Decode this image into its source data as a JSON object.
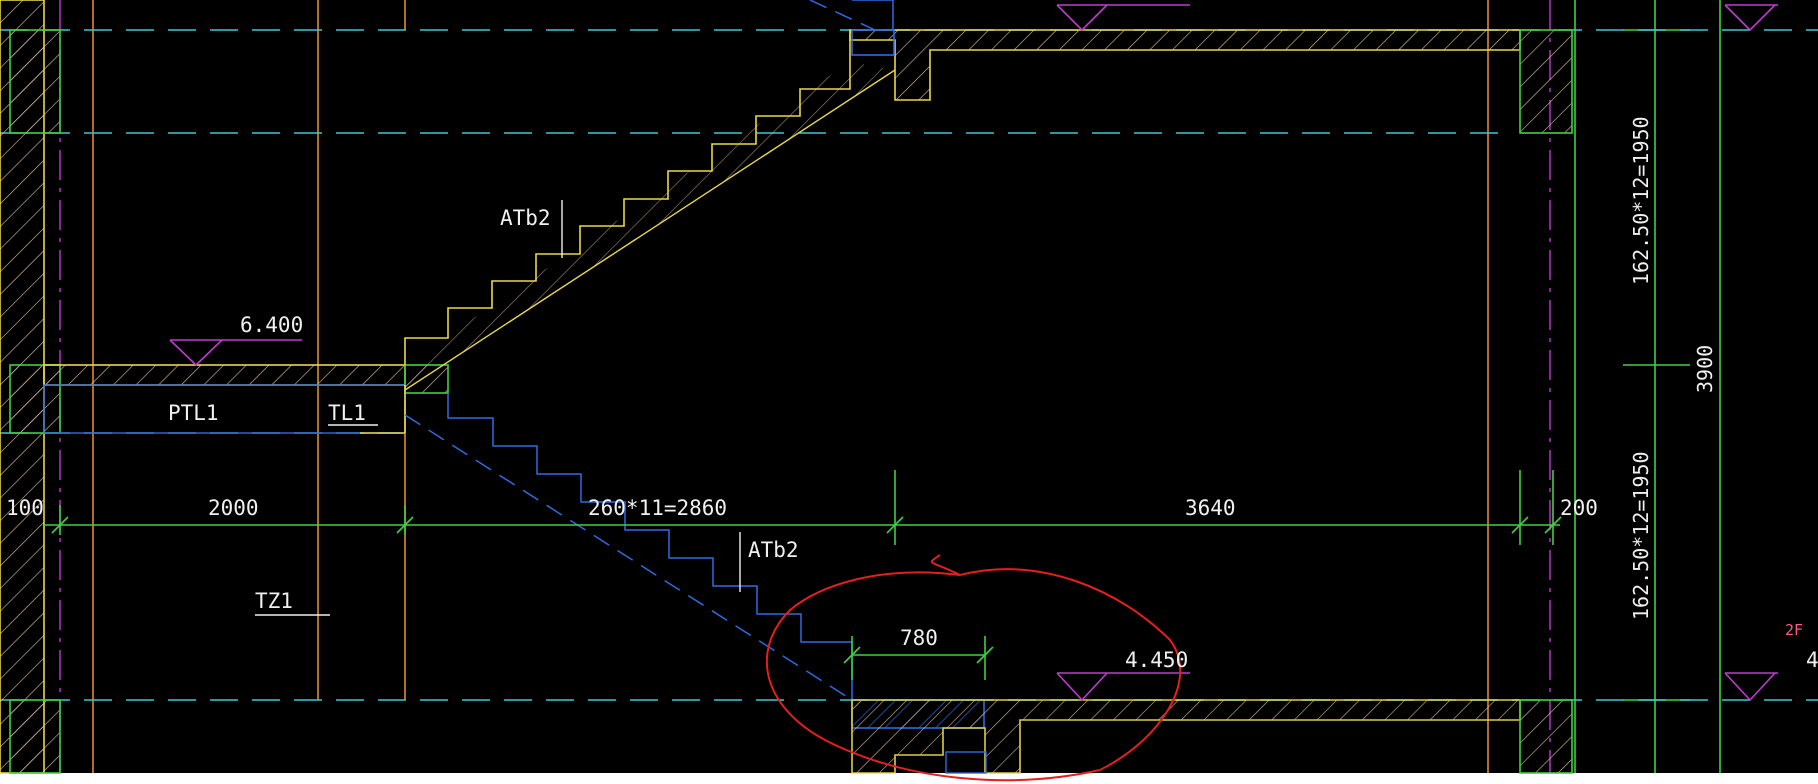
{
  "colors": {
    "background": "#000000",
    "wall": "#e8d84a",
    "grid_line": "#38c9cf",
    "dimension": "#3fd13f",
    "axis": "#e08a2a",
    "center_mark": "#c03ad0",
    "hidden_stair": "#2f6ae0",
    "markup_circle": "#e51e1e",
    "hatch": "#e7c3a0",
    "text": "#f0f0f0",
    "floor_tag": "#ff5a8c"
  },
  "labels": {
    "stair_upper": "ATb2",
    "stair_lower": "ATb2",
    "landing_beam": "PTL1",
    "stair_beam": "TL1",
    "stair_column": "TZ1"
  },
  "elevations": {
    "landing": "6.400",
    "floor": "4.450"
  },
  "dimensions": {
    "left_edge": "100",
    "landing": "2000",
    "run": "260*11=2860",
    "right_span": "3640",
    "right_edge": "200",
    "circled": "780",
    "vertical_upper": "162.50*12=1950",
    "vertical_lower": "162.50*12=1950",
    "vertical_total": "3900"
  },
  "floor_tag": "2F",
  "edge_fragment": "4"
}
